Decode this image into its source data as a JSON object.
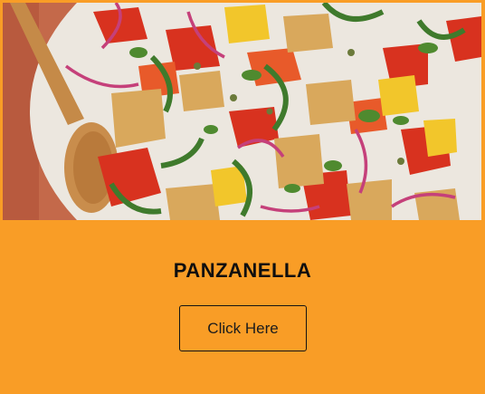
{
  "card": {
    "image_alt": "Panzanella salad",
    "title": "PANZANELLA",
    "button_label": "Click Here"
  },
  "colors": {
    "card_background": "#f99d26",
    "title_text": "#0f0f0f",
    "button_border": "#141414"
  }
}
